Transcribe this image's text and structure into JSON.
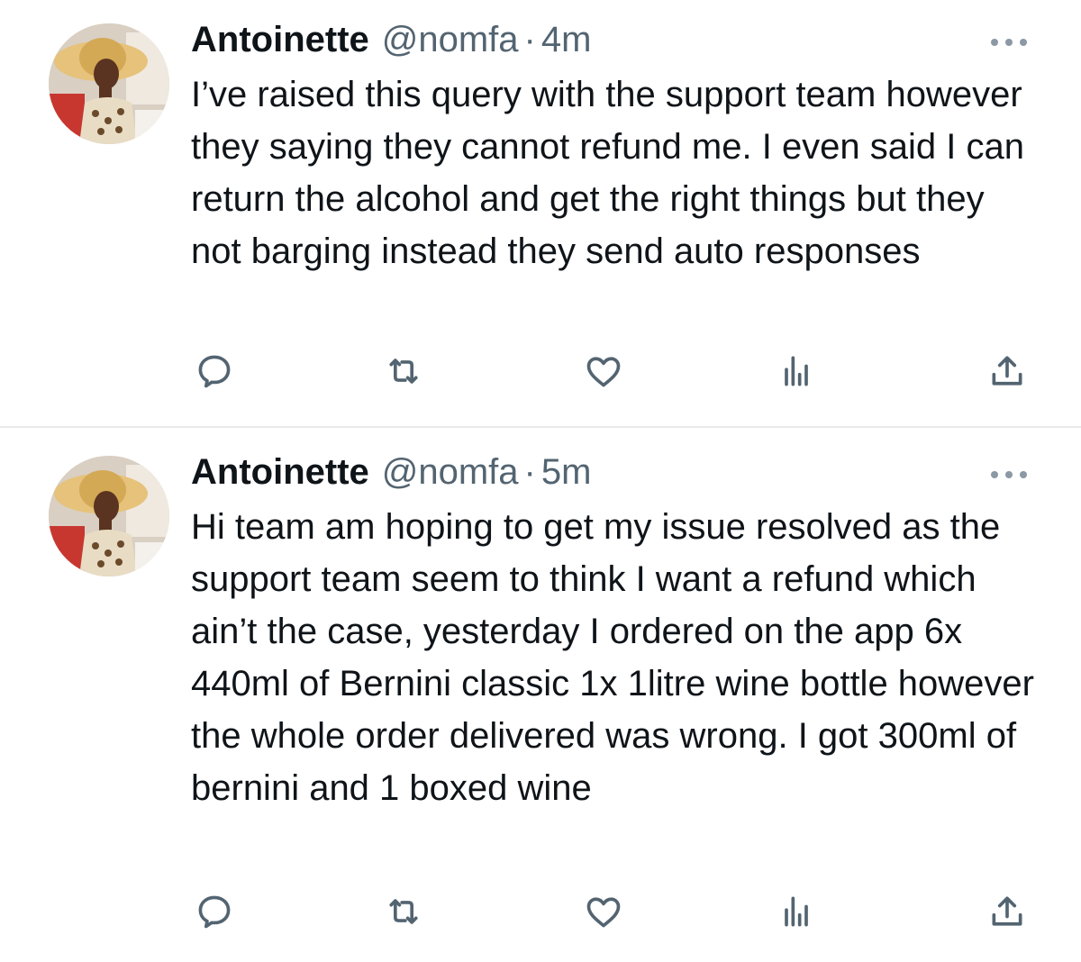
{
  "colors": {
    "text_primary": "#0f1419",
    "text_secondary": "#536471",
    "icon": "#536471",
    "divider": "#e7e9ea"
  },
  "tweets": [
    {
      "author_name": "Antoinette",
      "handle": "@nomfa",
      "separator": "·",
      "time": "4m",
      "text": "I’ve raised this query with the support team however they saying they cannot refund me. I even said I can return the alcohol and get the right things but they not barging instead they send auto responses",
      "actions": [
        "reply-icon",
        "retweet-icon",
        "like-icon",
        "views-icon",
        "share-icon"
      ]
    },
    {
      "author_name": "Antoinette",
      "handle": "@nomfa",
      "separator": "·",
      "time": "5m",
      "text": "Hi team am hoping to get my issue resolved as the support team seem to think I want a refund which ain’t the case, yesterday I ordered on the app 6x 440ml of Bernini classic 1x 1litre wine bottle however the whole order delivered was wrong. I got 300ml of bernini and 1 boxed wine",
      "actions": [
        "reply-icon",
        "retweet-icon",
        "like-icon",
        "views-icon",
        "share-icon"
      ]
    }
  ]
}
